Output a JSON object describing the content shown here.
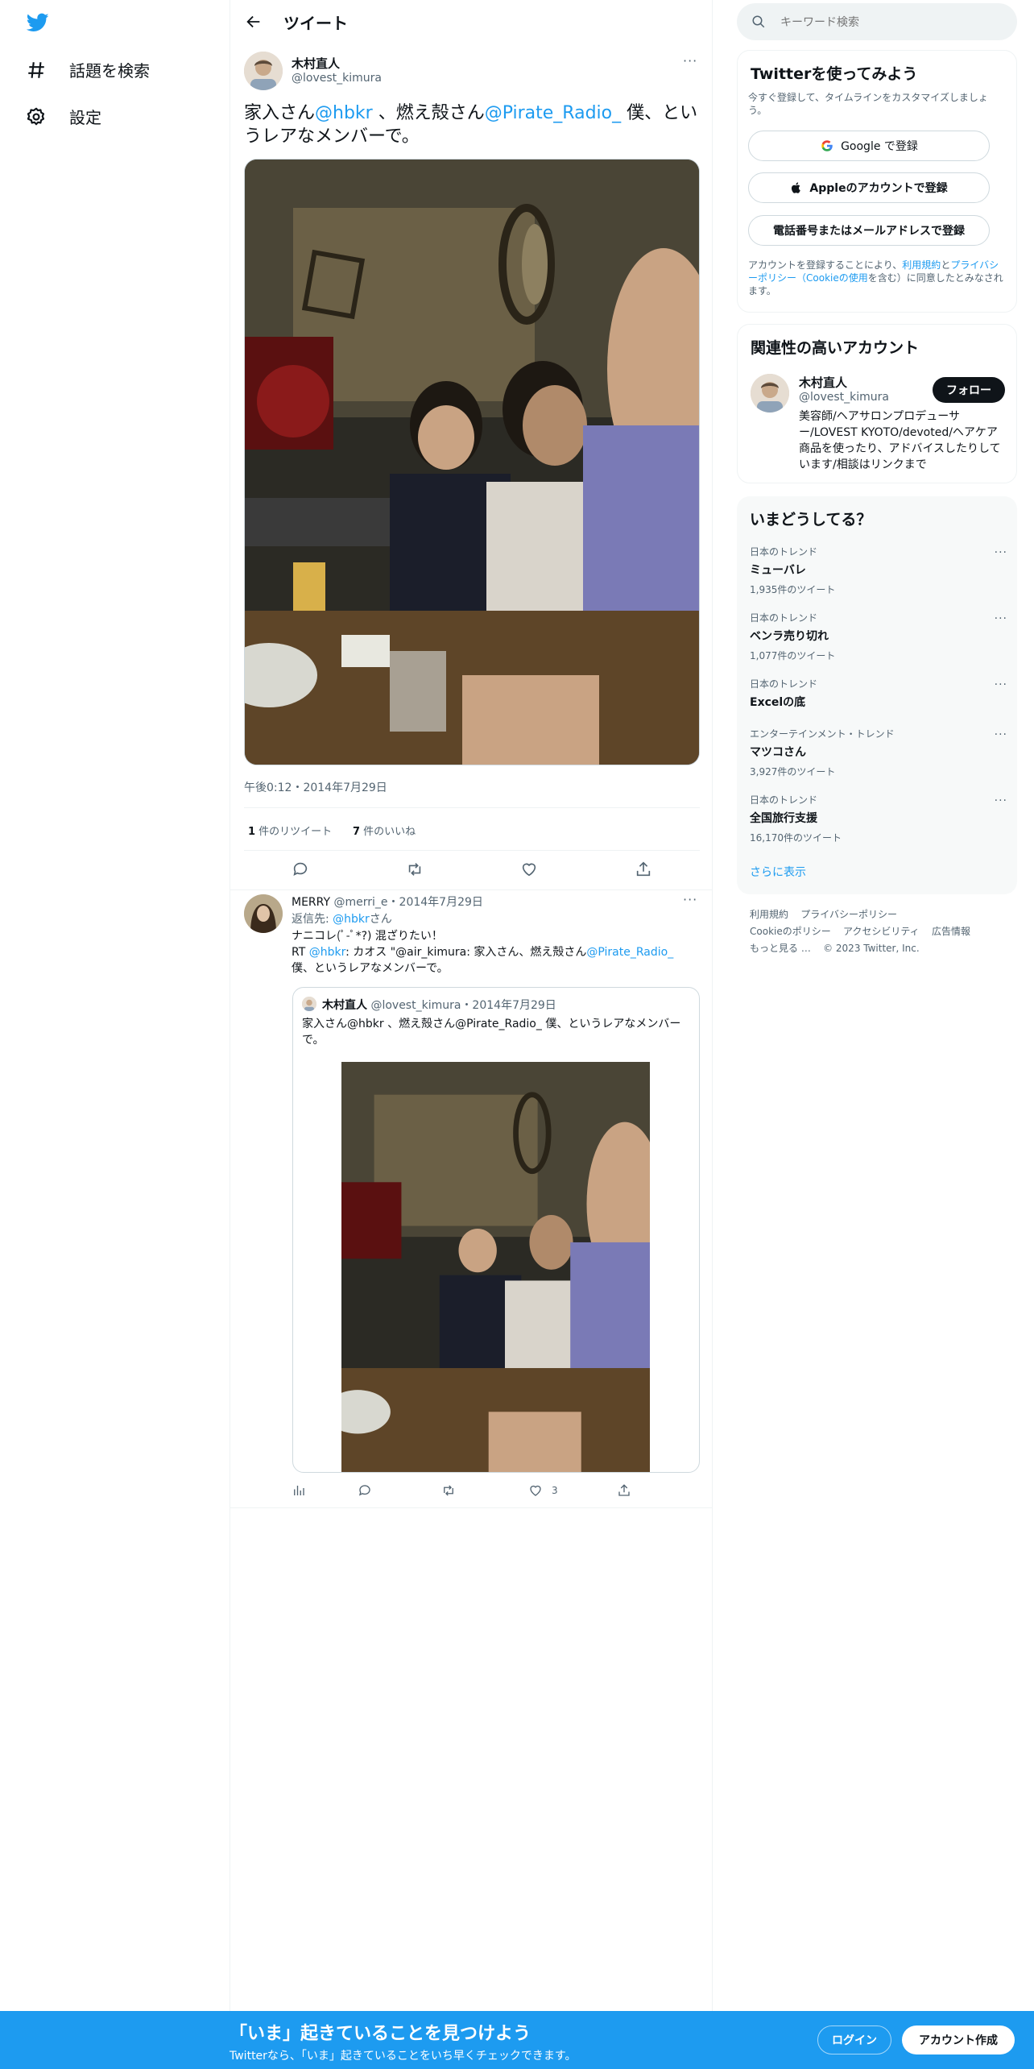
{
  "nav": {
    "explore_label": "話題を検索",
    "settings_label": "設定"
  },
  "header": {
    "title": "ツイート"
  },
  "main_tweet": {
    "author_name": "木村直人",
    "author_handle": "@lovest_kimura",
    "text_parts": [
      "家入さん",
      "@hbkr",
      " 、燃え殻さん",
      "@Pirate_Radio_",
      " 僕、というレアなメンバーで。"
    ],
    "time": "午後0:12・2014年7月29日",
    "retweets_count": "1",
    "retweets_label": " 件のリツイート",
    "likes_count": "7",
    "likes_label": " 件のいいね"
  },
  "reply": {
    "author_name": "MERRY",
    "author_handle": "@merri_e",
    "date": "・2014年7月29日",
    "reply_to_prefix": "返信先: ",
    "reply_to_handle": "@hbkr",
    "reply_to_suffix": "さん",
    "line1": "ナニコレ(ﾟ-ﾟ*?) 混ざりたい！",
    "rt_prefix": "RT ",
    "rt_handle": "@hbkr",
    "rt_text": ": カオス \"@air_kimura: 家入さん、燃え殻さん",
    "rt_handle2": "@Pirate_Radio_",
    "rt_tail": "僕、というレアなメンバーで。",
    "like_count": "3",
    "quote": {
      "author_name": "木村直人",
      "author_handle": "@lovest_kimura",
      "date": "・2014年7月29日",
      "text": "家入さん@hbkr 、燃え殻さん@Pirate_Radio_ 僕、というレアなメンバーで。"
    }
  },
  "sidebar": {
    "search_placeholder": "キーワード検索",
    "signup": {
      "title": "Twitterを使ってみよう",
      "subtitle": "今すぐ登録して、タイムラインをカスタマイズしましょう。",
      "google_label": "Google で登録",
      "apple_label": "Appleのアカウントで登録",
      "phone_label": "電話番号またはメールアドレスで登録",
      "legal_prefix": "アカウントを登録することにより、",
      "terms_link": "利用規約",
      "legal_and": "と",
      "privacy_link": "プライバシーポリシー",
      "cookie_link": "（Cookieの使用",
      "legal_suffix": "を含む）に同意したとみなされます。"
    },
    "related": {
      "title": "関連性の高いアカウント",
      "name": "木村直人",
      "handle": "@lovest_kimura",
      "follow_label": "フォロー",
      "bio": "美容師/ヘアサロンプロデューサー/LOVEST KYOTO/devoted/ヘアケア商品を使ったり、アドバイスしたりしています/相談はリンクまで"
    },
    "trends": {
      "title": "いまどうしてる？",
      "items": [
        {
          "category": "日本のトレンド",
          "name": "ミューバレ",
          "count": "1,935件のツイート"
        },
        {
          "category": "日本のトレンド",
          "name": "ベンラ売り切れ",
          "count": "1,077件のツイート"
        },
        {
          "category": "日本のトレンド",
          "name": "Excelの底",
          "count": ""
        },
        {
          "category": "エンターテインメント・トレンド",
          "name": "マツコさん",
          "count": "3,927件のツイート"
        },
        {
          "category": "日本のトレンド",
          "name": "全国旅行支援",
          "count": "16,170件のツイート"
        }
      ],
      "show_more": "さらに表示"
    },
    "footer": {
      "links": [
        "利用規約",
        "プライバシーポリシー",
        "Cookieのポリシー",
        "アクセシビリティ",
        "広告情報",
        "もっと見る …"
      ],
      "copyright": "© 2023 Twitter, Inc."
    }
  },
  "banner": {
    "title": "「いま」起きていることを見つけよう",
    "subtitle": "Twitterなら、「いま」起きていることをいち早くチェックできます。",
    "login_label": "ログイン",
    "signup_label": "アカウント作成"
  },
  "colors": {
    "brand": "#1d9bf0",
    "text": "#0f1419",
    "muted": "#536471"
  }
}
